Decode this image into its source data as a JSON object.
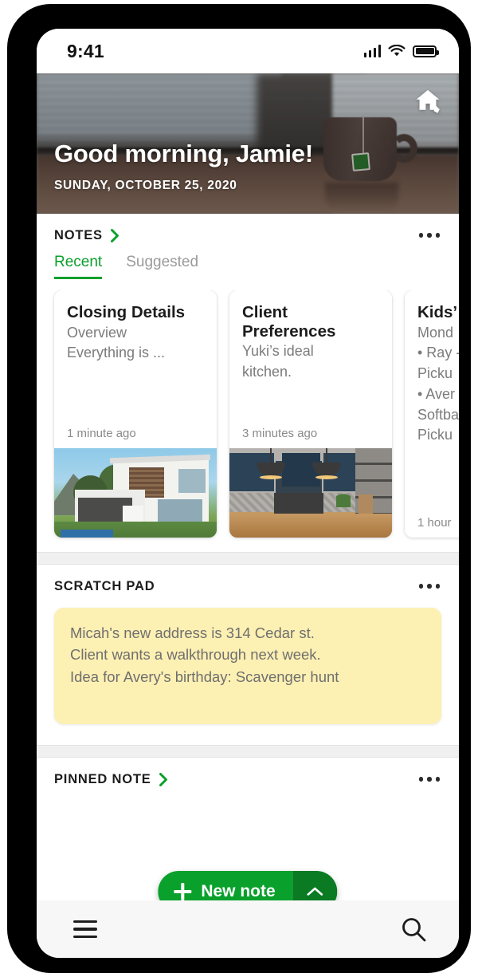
{
  "status_bar": {
    "time": "9:41",
    "signal_icon": "cellular-signal-icon",
    "wifi_icon": "wifi-icon",
    "battery_icon": "battery-full-icon"
  },
  "hero": {
    "greeting": "Good morning, Jamie!",
    "date": "SUNDAY, OCTOBER 25, 2020",
    "action_icon": "home-edit-icon",
    "background_description": "blurred office desk with coffee mug"
  },
  "notes_section": {
    "title": "NOTES",
    "chevron_icon": "chevron-right-icon",
    "overflow_icon": "kebab-menu-icon",
    "tabs": [
      {
        "label": "Recent",
        "active": true
      },
      {
        "label": "Suggested",
        "active": false
      }
    ],
    "cards": [
      {
        "title": "Closing Details",
        "snippet_line1": "Overview",
        "snippet_line2": "Everything is ...",
        "time": "1 minute ago",
        "image": "modern-white-house-photo"
      },
      {
        "title": "Client Preferences",
        "snippet_line1": "Yuki’s ideal",
        "snippet_line2": "kitchen.",
        "time": "3 minutes ago",
        "image": "navy-blue-kitchen-photo"
      },
      {
        "title": "Kids’",
        "snippet_line1": "Mond",
        "snippet_line2": "• Ray -",
        "snippet_line3": "Picku",
        "snippet_line4": "• Aver",
        "snippet_line5": "Softba",
        "snippet_line6": "Picku",
        "time": "1 hour",
        "image": "none"
      }
    ]
  },
  "scratch_pad": {
    "title": "SCRATCH PAD",
    "overflow_icon": "kebab-menu-icon",
    "background_color": "#fdf0b3",
    "lines": [
      "Micah's new address is 314 Cedar st.",
      "Client wants a walkthrough next week.",
      "Idea for Avery's birthday: Scavenger hunt"
    ]
  },
  "pinned_note": {
    "title": "PINNED NOTE",
    "chevron_icon": "chevron-right-icon",
    "overflow_icon": "kebab-menu-icon"
  },
  "fab": {
    "label": "New note",
    "plus_icon": "plus-icon",
    "caret_icon": "chevron-up-icon",
    "color": "#0aa02c",
    "caret_color": "#0a7a23"
  },
  "bottom_bar": {
    "menu_icon": "hamburger-menu-icon",
    "search_icon": "search-icon"
  },
  "theme": {
    "accent_green": "#0aa02c",
    "accent_green_dark": "#0a7a23",
    "text_primary": "#1c1c1c",
    "text_secondary": "#7b7b7b",
    "band_gray": "#f0f0f0"
  }
}
